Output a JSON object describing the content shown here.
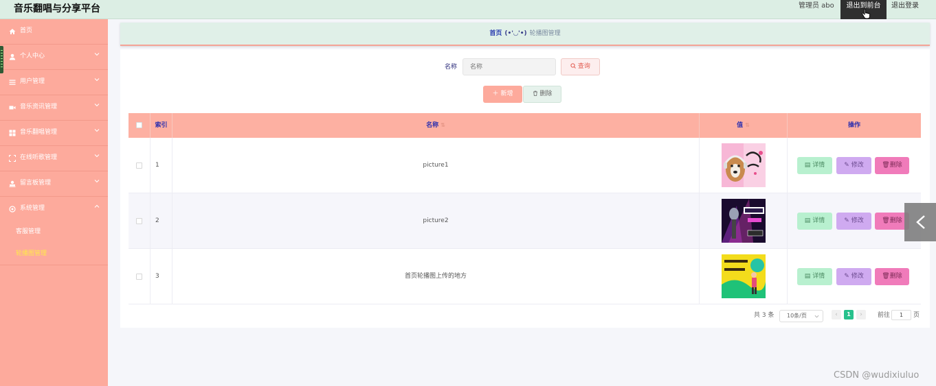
{
  "header": {
    "app_title": "音乐翻唱与分享平台",
    "admin_label": "管理员 abo",
    "front_button": "退出到前台",
    "logout_button": "退出登录"
  },
  "sidebar": {
    "items": [
      {
        "label": "首页",
        "icon": "home-icon"
      },
      {
        "label": "个人中心",
        "icon": "user-icon"
      },
      {
        "label": "用户管理",
        "icon": "list-icon"
      },
      {
        "label": "音乐资讯管理",
        "icon": "video-icon"
      },
      {
        "label": "音乐翻唱管理",
        "icon": "grid-icon"
      },
      {
        "label": "在线听歌管理",
        "icon": "expand-icon"
      },
      {
        "label": "留言板管理",
        "icon": "person-stamp-icon"
      },
      {
        "label": "系统管理",
        "icon": "gear-icon"
      }
    ],
    "sub_items": [
      {
        "label": "客服管理",
        "active": false
      },
      {
        "label": "轮播图管理",
        "active": true
      }
    ]
  },
  "breadcrumb": {
    "home": "首页",
    "separator": "(•'◡'•)",
    "current": "轮播图管理"
  },
  "search": {
    "label": "名称",
    "placeholder": "名称",
    "button": "查询"
  },
  "actions": {
    "add": "新增",
    "delete": "删除"
  },
  "table": {
    "headers": {
      "index": "索引",
      "name": "名称",
      "value": "值",
      "ops": "操作"
    },
    "rows": [
      {
        "index": "1",
        "name": "picture1",
        "image": "dog-headphones-banner"
      },
      {
        "index": "2",
        "name": "picture2",
        "image": "microphone-top10-banner"
      },
      {
        "index": "3",
        "name": "首页轮播图上传的地方",
        "image": "yellow-green-singer-banner"
      }
    ],
    "op_labels": {
      "detail": "详情",
      "edit": "修改",
      "delete": "删除"
    }
  },
  "pagination": {
    "total": "共 3 条",
    "page_size": "10条/页",
    "current_page": "1",
    "goto_label": "前往",
    "goto_value": "1",
    "page_unit": "页"
  },
  "watermark": "CSDN @wudixiuluo",
  "colors": {
    "header_bg": "#dceee4",
    "sidebar_bg": "#fdaa9c",
    "table_head_bg": "#fdb0a2",
    "detail_btn": "#b8f0cf",
    "edit_btn": "#cfaaf0",
    "delete_btn": "#f07bba",
    "page_active": "#27c18c"
  }
}
